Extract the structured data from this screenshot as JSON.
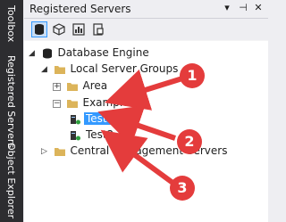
{
  "sidebar": {
    "tabs": [
      "Toolbox",
      "Registered Servers",
      "Object Explorer"
    ]
  },
  "panel": {
    "title": "Registered Servers",
    "title_buttons": {
      "dropdown": "▾",
      "pin": "⊣",
      "close": "✕"
    }
  },
  "toolbar": {
    "tools": [
      "database-engine-icon",
      "analysis-services-icon",
      "reporting-services-icon",
      "integration-services-icon"
    ]
  },
  "tree": {
    "root": "Database Engine",
    "local_groups": "Local Server Groups",
    "area": "Area",
    "example": "Example",
    "server1": "Test1",
    "server2": "Test2",
    "central": "Central Management Servers"
  },
  "annotations": {
    "badges": [
      "1",
      "2",
      "3"
    ],
    "color": "#e43c3c"
  },
  "colors": {
    "selection": "#3399ff",
    "folder": "#dcb45a",
    "dark_bar": "#2d2d30"
  }
}
